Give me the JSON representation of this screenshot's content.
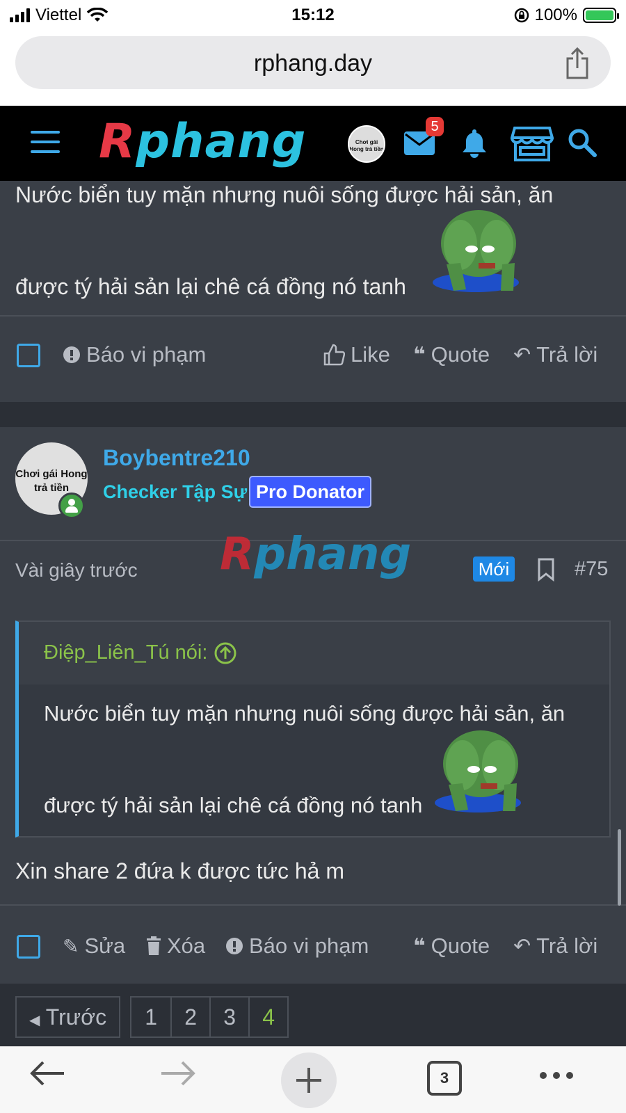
{
  "status_bar": {
    "carrier": "Viettel",
    "time": "15:12",
    "battery": "100%",
    "battery_level": 1.0
  },
  "browser": {
    "url": "rphang.day",
    "tab_count": "3"
  },
  "site_header": {
    "logo_prefix": "R",
    "logo_rest": "phang",
    "avatar_text": "Chơi gái Hong trả tiền",
    "mail_badge": "5",
    "icons": [
      "menu-icon",
      "mail-icon",
      "bell-icon",
      "store-icon",
      "search-icon"
    ]
  },
  "post1": {
    "line1": "Nước biển tuy mặn nhưng nuôi sống được hải sản, ăn",
    "line2": "được tý hải sản lại chê cá đồng nó tanh",
    "actions": {
      "report": "Báo vi phạm",
      "like": "Like",
      "quote": "Quote",
      "reply": "Trả lời"
    }
  },
  "post2": {
    "username": "Boybentre210",
    "user_title": "Checker Tập Sự",
    "badge": "Pro Donator",
    "avatar_text": "Chơi gái Hong trả tiền",
    "time": "Vài giây trước",
    "watermark_prefix": "R",
    "watermark_rest": "phang",
    "new_badge": "Mới",
    "post_number": "#75",
    "quote": {
      "author": "Điệp_Liên_Tú nói:",
      "line1": "Nước biển tuy mặn nhưng nuôi sống được hải sản, ăn",
      "line2": "được tý hải sản lại chê cá đồng nó tanh"
    },
    "reply": "Xin share 2 đứa k được tức hả m",
    "actions": {
      "edit": "Sửa",
      "delete": "Xóa",
      "report": "Báo vi phạm",
      "quote": "Quote",
      "reply": "Trả lời"
    }
  },
  "pagination": {
    "prev": "Trước",
    "pages": [
      "1",
      "2",
      "3",
      "4"
    ],
    "current": "4"
  },
  "colors": {
    "accent": "#3fa9e8",
    "background": "#2b2f36",
    "post_bg": "#3a3f47",
    "user_title": "#2fd0e8",
    "badge": "#3d5afe",
    "quote_author": "#8bc34a"
  }
}
